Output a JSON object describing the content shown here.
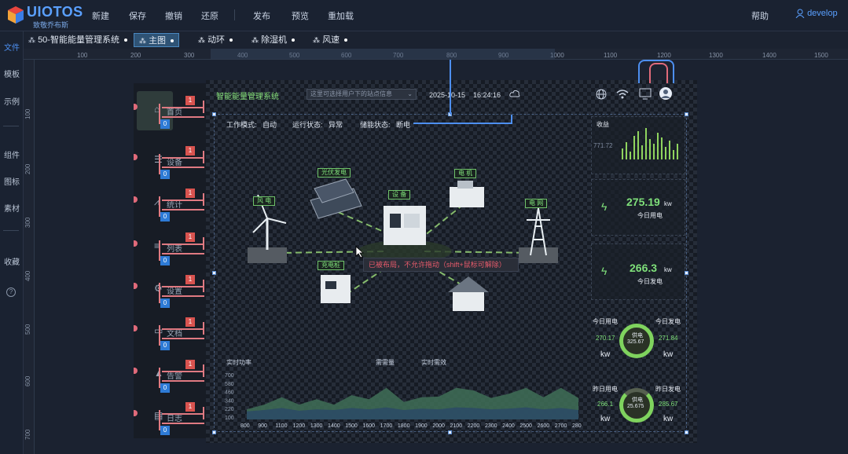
{
  "app": {
    "name": "UIOTOS",
    "tagline": "致敬乔布斯"
  },
  "toolbar": {
    "new": "新建",
    "save": "保存",
    "undo": "撤销",
    "restore": "还原",
    "publish": "发布",
    "preview": "预览",
    "reload": "重加载",
    "help": "帮助",
    "user": "develop"
  },
  "left_rail": {
    "file": "文件",
    "template": "模板",
    "example": "示例",
    "component": "组件",
    "icon": "图标",
    "material": "素材",
    "favorite": "收藏",
    "help_icon": "?"
  },
  "tabs": [
    {
      "label": "50-智能能量管理系统"
    },
    {
      "label": "主图"
    },
    {
      "label": "动环"
    },
    {
      "label": "除湿机"
    },
    {
      "label": "风速"
    }
  ],
  "ruler": {
    "h_ticks": [
      "100",
      "200",
      "300",
      "400",
      "500",
      "600",
      "700",
      "800",
      "900",
      "1000",
      "1100",
      "1200",
      "1300",
      "1400",
      "1500"
    ],
    "v_ticks": [
      "100",
      "200",
      "300",
      "400",
      "500",
      "600",
      "700"
    ]
  },
  "side_nav": [
    {
      "label": "首页",
      "icon": "home-icon",
      "badge_top": "1",
      "badge_bottom": "0"
    },
    {
      "label": "设备",
      "icon": "server-icon",
      "badge_top": "1",
      "badge_bottom": "0"
    },
    {
      "label": "统计",
      "icon": "chart-icon",
      "badge_top": "1",
      "badge_bottom": "0"
    },
    {
      "label": "列表",
      "icon": "list-icon",
      "badge_top": "1",
      "badge_bottom": "0"
    },
    {
      "label": "设置",
      "icon": "gear-icon",
      "badge_top": "1",
      "badge_bottom": "0"
    },
    {
      "label": "文档",
      "icon": "folder-icon",
      "badge_top": "1",
      "badge_bottom": "0"
    },
    {
      "label": "告警",
      "icon": "warning-icon",
      "badge_top": "1",
      "badge_bottom": "0"
    },
    {
      "label": "日志",
      "icon": "doc-icon",
      "badge_top": "1",
      "badge_bottom": "0"
    }
  ],
  "dashboard": {
    "title": "智能能量管理系统",
    "select_text": "这里可选择用户下的站点信息",
    "date": "2025-10-15",
    "time": "16:24:16",
    "work_mode_label": "工作模式:",
    "work_mode": "自动",
    "run_state_label": "运行状态:",
    "run_state": "异常",
    "storage_state_label": "储能状态:",
    "storage_state": "断电",
    "nodes": {
      "wind": "风 电",
      "pv": "光伏发电",
      "device": "设 备",
      "motor": "电 机",
      "grid": "电 网",
      "charger": "充电桩"
    },
    "warning": "已被布局，不允许拖动（shift+鼠标可解除）"
  },
  "right_cards": {
    "chart_label": "收益",
    "chart_value": "771.72",
    "today_use_value": "275.19",
    "today_use_unit": "kw",
    "today_use_label": "今日用电",
    "today_gen_value": "266.3",
    "today_gen_unit": "kw",
    "today_gen_label": "今日发电",
    "ring1": {
      "left_label": "今日用电",
      "right_label": "今日发电",
      "left_value": "270.17",
      "right_value": "271.84",
      "center_label": "供电",
      "center_value": "325.67",
      "left_unit": "kw",
      "right_unit": "kw"
    },
    "ring2": {
      "left_label": "昨日用电",
      "right_label": "昨日发电",
      "left_value": "266.1",
      "right_value": "285.67",
      "center_label": "供电",
      "center_value": "25.675",
      "left_unit": "kw",
      "right_unit": "kw"
    }
  },
  "area_chart": {
    "title": "实时功率",
    "legend_1": "需需量",
    "legend_2": "实时需效",
    "y_ticks": [
      "700",
      "580",
      "460",
      "340",
      "220",
      "100"
    ],
    "x_ticks": [
      "800",
      "900",
      "1100",
      "1200",
      "1300",
      "1400",
      "1500",
      "1600",
      "1700",
      "1800",
      "1900",
      "2000",
      "2100",
      "2200",
      "2300",
      "2400",
      "2500",
      "2600",
      "2700",
      "2800"
    ]
  },
  "chart_data": {
    "type": "area",
    "x": [
      "800",
      "900",
      "1100",
      "1200",
      "1300",
      "1400",
      "1500",
      "1600",
      "1700",
      "1800",
      "1900",
      "2000",
      "2100",
      "2200",
      "2300",
      "2400",
      "2500",
      "2600",
      "2700",
      "2800"
    ],
    "series": [
      {
        "name": "需需量",
        "values": [
          150,
          220,
          330,
          220,
          300,
          220,
          360,
          300,
          470,
          260,
          330,
          340,
          470,
          430,
          320,
          380,
          470,
          330,
          470,
          320
        ]
      },
      {
        "name": "实时需效",
        "values": [
          120,
          140,
          170,
          130,
          150,
          140,
          170,
          150,
          180,
          140,
          160,
          150,
          180,
          170,
          150,
          160,
          180,
          150,
          170,
          140
        ]
      }
    ],
    "ylim": [
      0,
      700
    ]
  },
  "colors": {
    "accent": "#4d8ff0",
    "green": "#7fe07a",
    "badge_red": "#d9534f",
    "badge_blue": "#2e7bd6",
    "warn": "#e85b6b"
  }
}
